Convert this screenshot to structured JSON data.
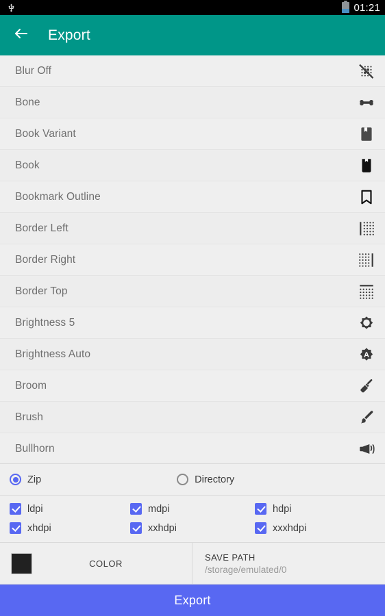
{
  "statusbar": {
    "usb_icon": "usb-icon",
    "battery_icon": "battery-icon",
    "clock": "01:21"
  },
  "appbar": {
    "back_icon": "back-arrow-icon",
    "title": "Export",
    "color": "#009688"
  },
  "icon_list": [
    {
      "label": "Blur Off",
      "icon": "blur-off-icon"
    },
    {
      "label": "Bone",
      "icon": "bone-icon"
    },
    {
      "label": "Book Variant",
      "icon": "book-variant-icon"
    },
    {
      "label": "Book",
      "icon": "book-icon"
    },
    {
      "label": "Bookmark Outline",
      "icon": "bookmark-outline-icon"
    },
    {
      "label": "Border Left",
      "icon": "border-left-icon"
    },
    {
      "label": "Border Right",
      "icon": "border-right-icon"
    },
    {
      "label": "Border Top",
      "icon": "border-top-icon"
    },
    {
      "label": "Brightness 5",
      "icon": "brightness-5-icon"
    },
    {
      "label": "Brightness Auto",
      "icon": "brightness-auto-icon"
    },
    {
      "label": "Broom",
      "icon": "broom-icon"
    },
    {
      "label": "Brush",
      "icon": "brush-icon"
    },
    {
      "label": "Bullhorn",
      "icon": "bullhorn-icon"
    }
  ],
  "options": {
    "output_mode": {
      "selected": "Zip",
      "choices": [
        {
          "label": "Zip",
          "checked": true
        },
        {
          "label": "Directory",
          "checked": false
        }
      ]
    },
    "densities": [
      {
        "label": "ldpi",
        "checked": true
      },
      {
        "label": "mdpi",
        "checked": true
      },
      {
        "label": "hdpi",
        "checked": true
      },
      {
        "label": "xhdpi",
        "checked": true
      },
      {
        "label": "xxhdpi",
        "checked": true
      },
      {
        "label": "xxxhdpi",
        "checked": true
      }
    ],
    "color": {
      "label": "COLOR",
      "value": "#212121"
    },
    "save_path": {
      "title": "SAVE PATH",
      "value": "/storage/emulated/0"
    }
  },
  "export_button": {
    "label": "Export",
    "color": "#5868f2"
  }
}
